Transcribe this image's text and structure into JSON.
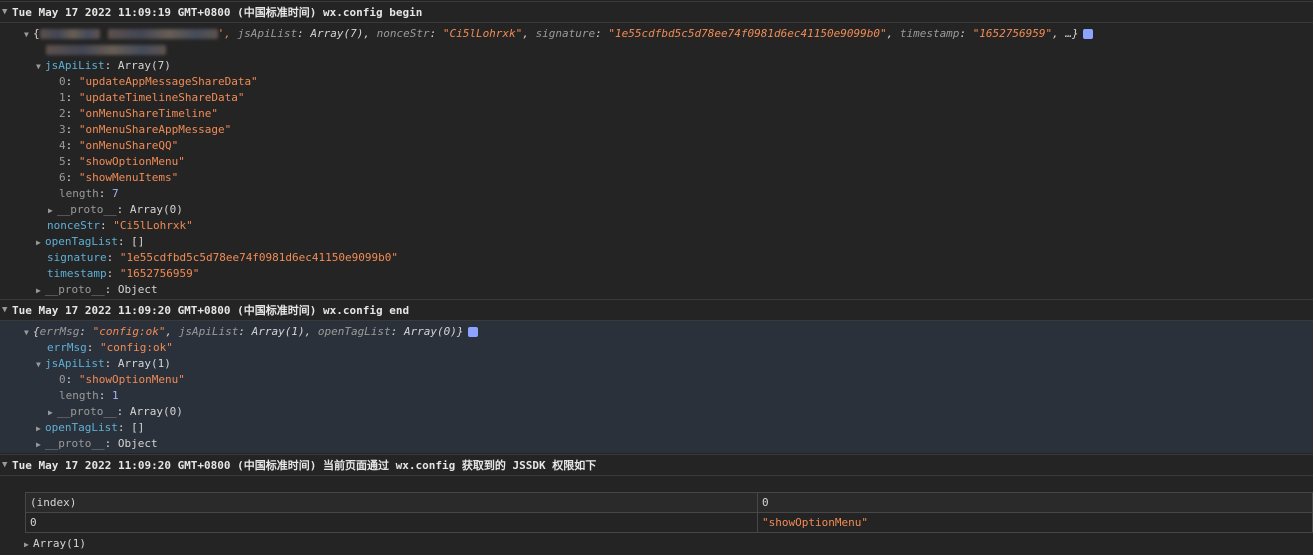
{
  "groups": [
    {
      "header": "Tue May 17 2022 11:09:19 GMT+0800 (中国标准时间) wx.config begin",
      "summary": {
        "open": "{",
        "tail_quote": "',",
        "k1": "jsApiList",
        "v1": "Array(7)",
        "k2": "nonceStr",
        "v2": "\"Ci5lLohrxk\"",
        "k3": "signature",
        "v3": "\"1e55cdfbd5c5d78ee74f0981d6ec41150e9099b0\"",
        "k4": "timestamp",
        "v4": "\"1652756959\"",
        "ellipsis": ", …}"
      },
      "jsApiList": {
        "key": "jsApiList",
        "type": "Array(7)",
        "items": [
          {
            "index": "0",
            "value": "\"updateAppMessageShareData\""
          },
          {
            "index": "1",
            "value": "\"updateTimelineShareData\""
          },
          {
            "index": "2",
            "value": "\"onMenuShareTimeline\""
          },
          {
            "index": "3",
            "value": "\"onMenuShareAppMessage\""
          },
          {
            "index": "4",
            "value": "\"onMenuShareQQ\""
          },
          {
            "index": "5",
            "value": "\"showOptionMenu\""
          },
          {
            "index": "6",
            "value": "\"showMenuItems\""
          }
        ],
        "length_key": "length",
        "length_val": "7",
        "proto_key": "__proto__",
        "proto_val": "Array(0)"
      },
      "nonceStr": {
        "key": "nonceStr",
        "val": "\"Ci5lLohrxk\""
      },
      "openTagList": {
        "key": "openTagList",
        "val": "[]"
      },
      "signature": {
        "key": "signature",
        "val": "\"1e55cdfbd5c5d78ee74f0981d6ec41150e9099b0\""
      },
      "timestamp": {
        "key": "timestamp",
        "val": "\"1652756959\""
      },
      "proto": {
        "key": "__proto__",
        "val": "Object"
      }
    },
    {
      "header": "Tue May 17 2022 11:09:20 GMT+0800 (中国标准时间) wx.config end",
      "summary": "{errMsg: \"config:ok\", jsApiList: Array(1), openTagList: Array(0)}",
      "summary_parts": {
        "open": "{",
        "k1": "errMsg",
        "v1": "\"config:ok\"",
        "k2": "jsApiList",
        "v2": "Array(1)",
        "k3": "openTagList",
        "v3": "Array(0)",
        "close": "}"
      },
      "errMsg": {
        "key": "errMsg",
        "val": "\"config:ok\""
      },
      "jsApiList": {
        "key": "jsApiList",
        "type": "Array(1)",
        "items": [
          {
            "index": "0",
            "value": "\"showOptionMenu\""
          }
        ],
        "length_key": "length",
        "length_val": "1",
        "proto_key": "__proto__",
        "proto_val": "Array(0)"
      },
      "openTagList": {
        "key": "openTagList",
        "val": "[]"
      },
      "proto": {
        "key": "__proto__",
        "val": "Object"
      }
    },
    {
      "header": "Tue May 17 2022 11:09:20 GMT+0800 (中国标准时间) 当前页面通过 wx.config 获取到的 JSSDK 权限如下",
      "table": {
        "headers": [
          "(index)",
          "0"
        ],
        "rows": [
          [
            "0",
            "\"showOptionMenu\""
          ]
        ]
      },
      "footer": "Array(1)"
    }
  ],
  "colors": {
    "background": "#242424",
    "key": "#5db0d7",
    "string": "#f28b54",
    "number": "#9980ff"
  }
}
